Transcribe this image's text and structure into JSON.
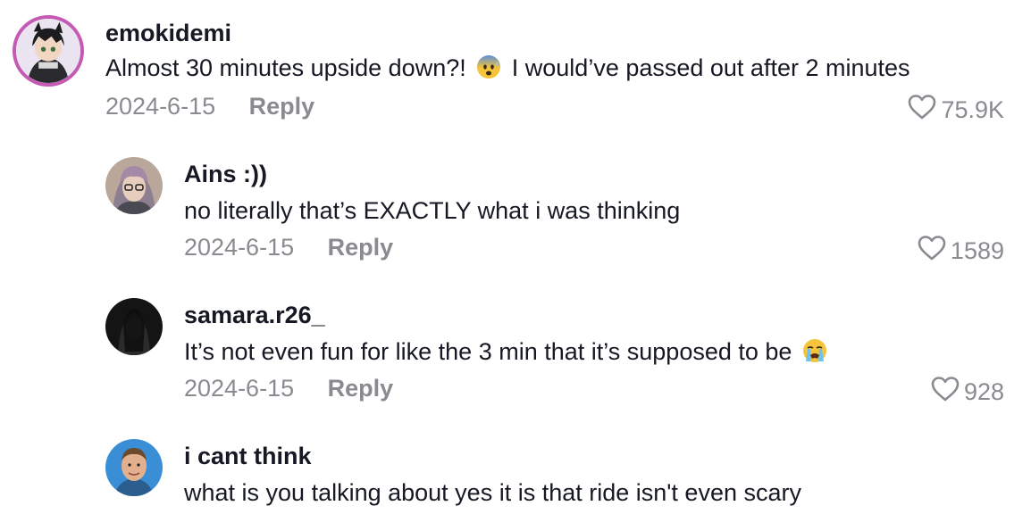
{
  "comments": [
    {
      "username": "emokidemi",
      "text_before": "Almost 30 minutes upside down?!",
      "emoji": "anxious-face-with-sweat",
      "text_after": "I would’ve passed out after 2 minutes",
      "date": "2024-6-15",
      "reply_label": "Reply",
      "likes": "75.9K"
    },
    {
      "username": "Ains :))",
      "text": "no literally that’s EXACTLY what i was thinking",
      "date": "2024-6-15",
      "reply_label": "Reply",
      "likes": "1589"
    },
    {
      "username": "samara.r26_",
      "text_before": "It’s not even fun for like the 3 min that it’s supposed to be",
      "emoji": "loudly-crying-face",
      "date": "2024-6-15",
      "reply_label": "Reply",
      "likes": "928"
    },
    {
      "username": "i cant think",
      "text": "what is you talking about yes it is that ride isn't even scary"
    }
  ]
}
